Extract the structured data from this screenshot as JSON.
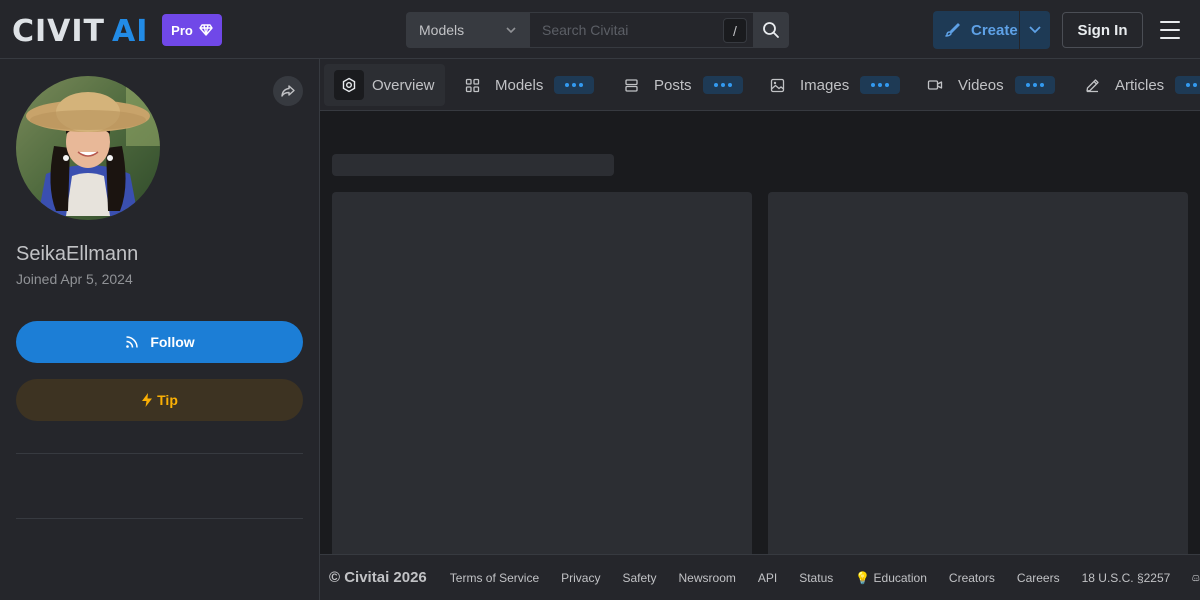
{
  "header": {
    "logo_text": "CIVITAI",
    "pro_label": "Pro",
    "search": {
      "category": "Models",
      "placeholder": "Search Civitai",
      "shortcut": "/"
    },
    "create_label": "Create",
    "signin_label": "Sign In"
  },
  "profile": {
    "username": "SeikaEllmann",
    "joined": "Joined Apr 5, 2024",
    "follow_label": "Follow",
    "tip_label": "Tip"
  },
  "tabs": [
    {
      "label": "Overview",
      "icon": "overview-icon",
      "active": true
    },
    {
      "label": "Models",
      "icon": "grid-icon"
    },
    {
      "label": "Posts",
      "icon": "posts-icon"
    },
    {
      "label": "Images",
      "icon": "image-icon"
    },
    {
      "label": "Videos",
      "icon": "video-icon"
    },
    {
      "label": "Articles",
      "icon": "pencil-icon"
    }
  ],
  "footer": {
    "copyright": "© Civitai 2026",
    "links": [
      "Terms of Service",
      "Privacy",
      "Safety",
      "Newsroom",
      "API",
      "Status",
      "💡 Education",
      "Creators",
      "Careers",
      "18 U.S.C. §2257"
    ]
  },
  "colors": {
    "accent": "#1c7ed6",
    "pro": "#7048e8",
    "tip": "#fab005",
    "background": "#1a1b1e",
    "surface": "#25262b"
  }
}
